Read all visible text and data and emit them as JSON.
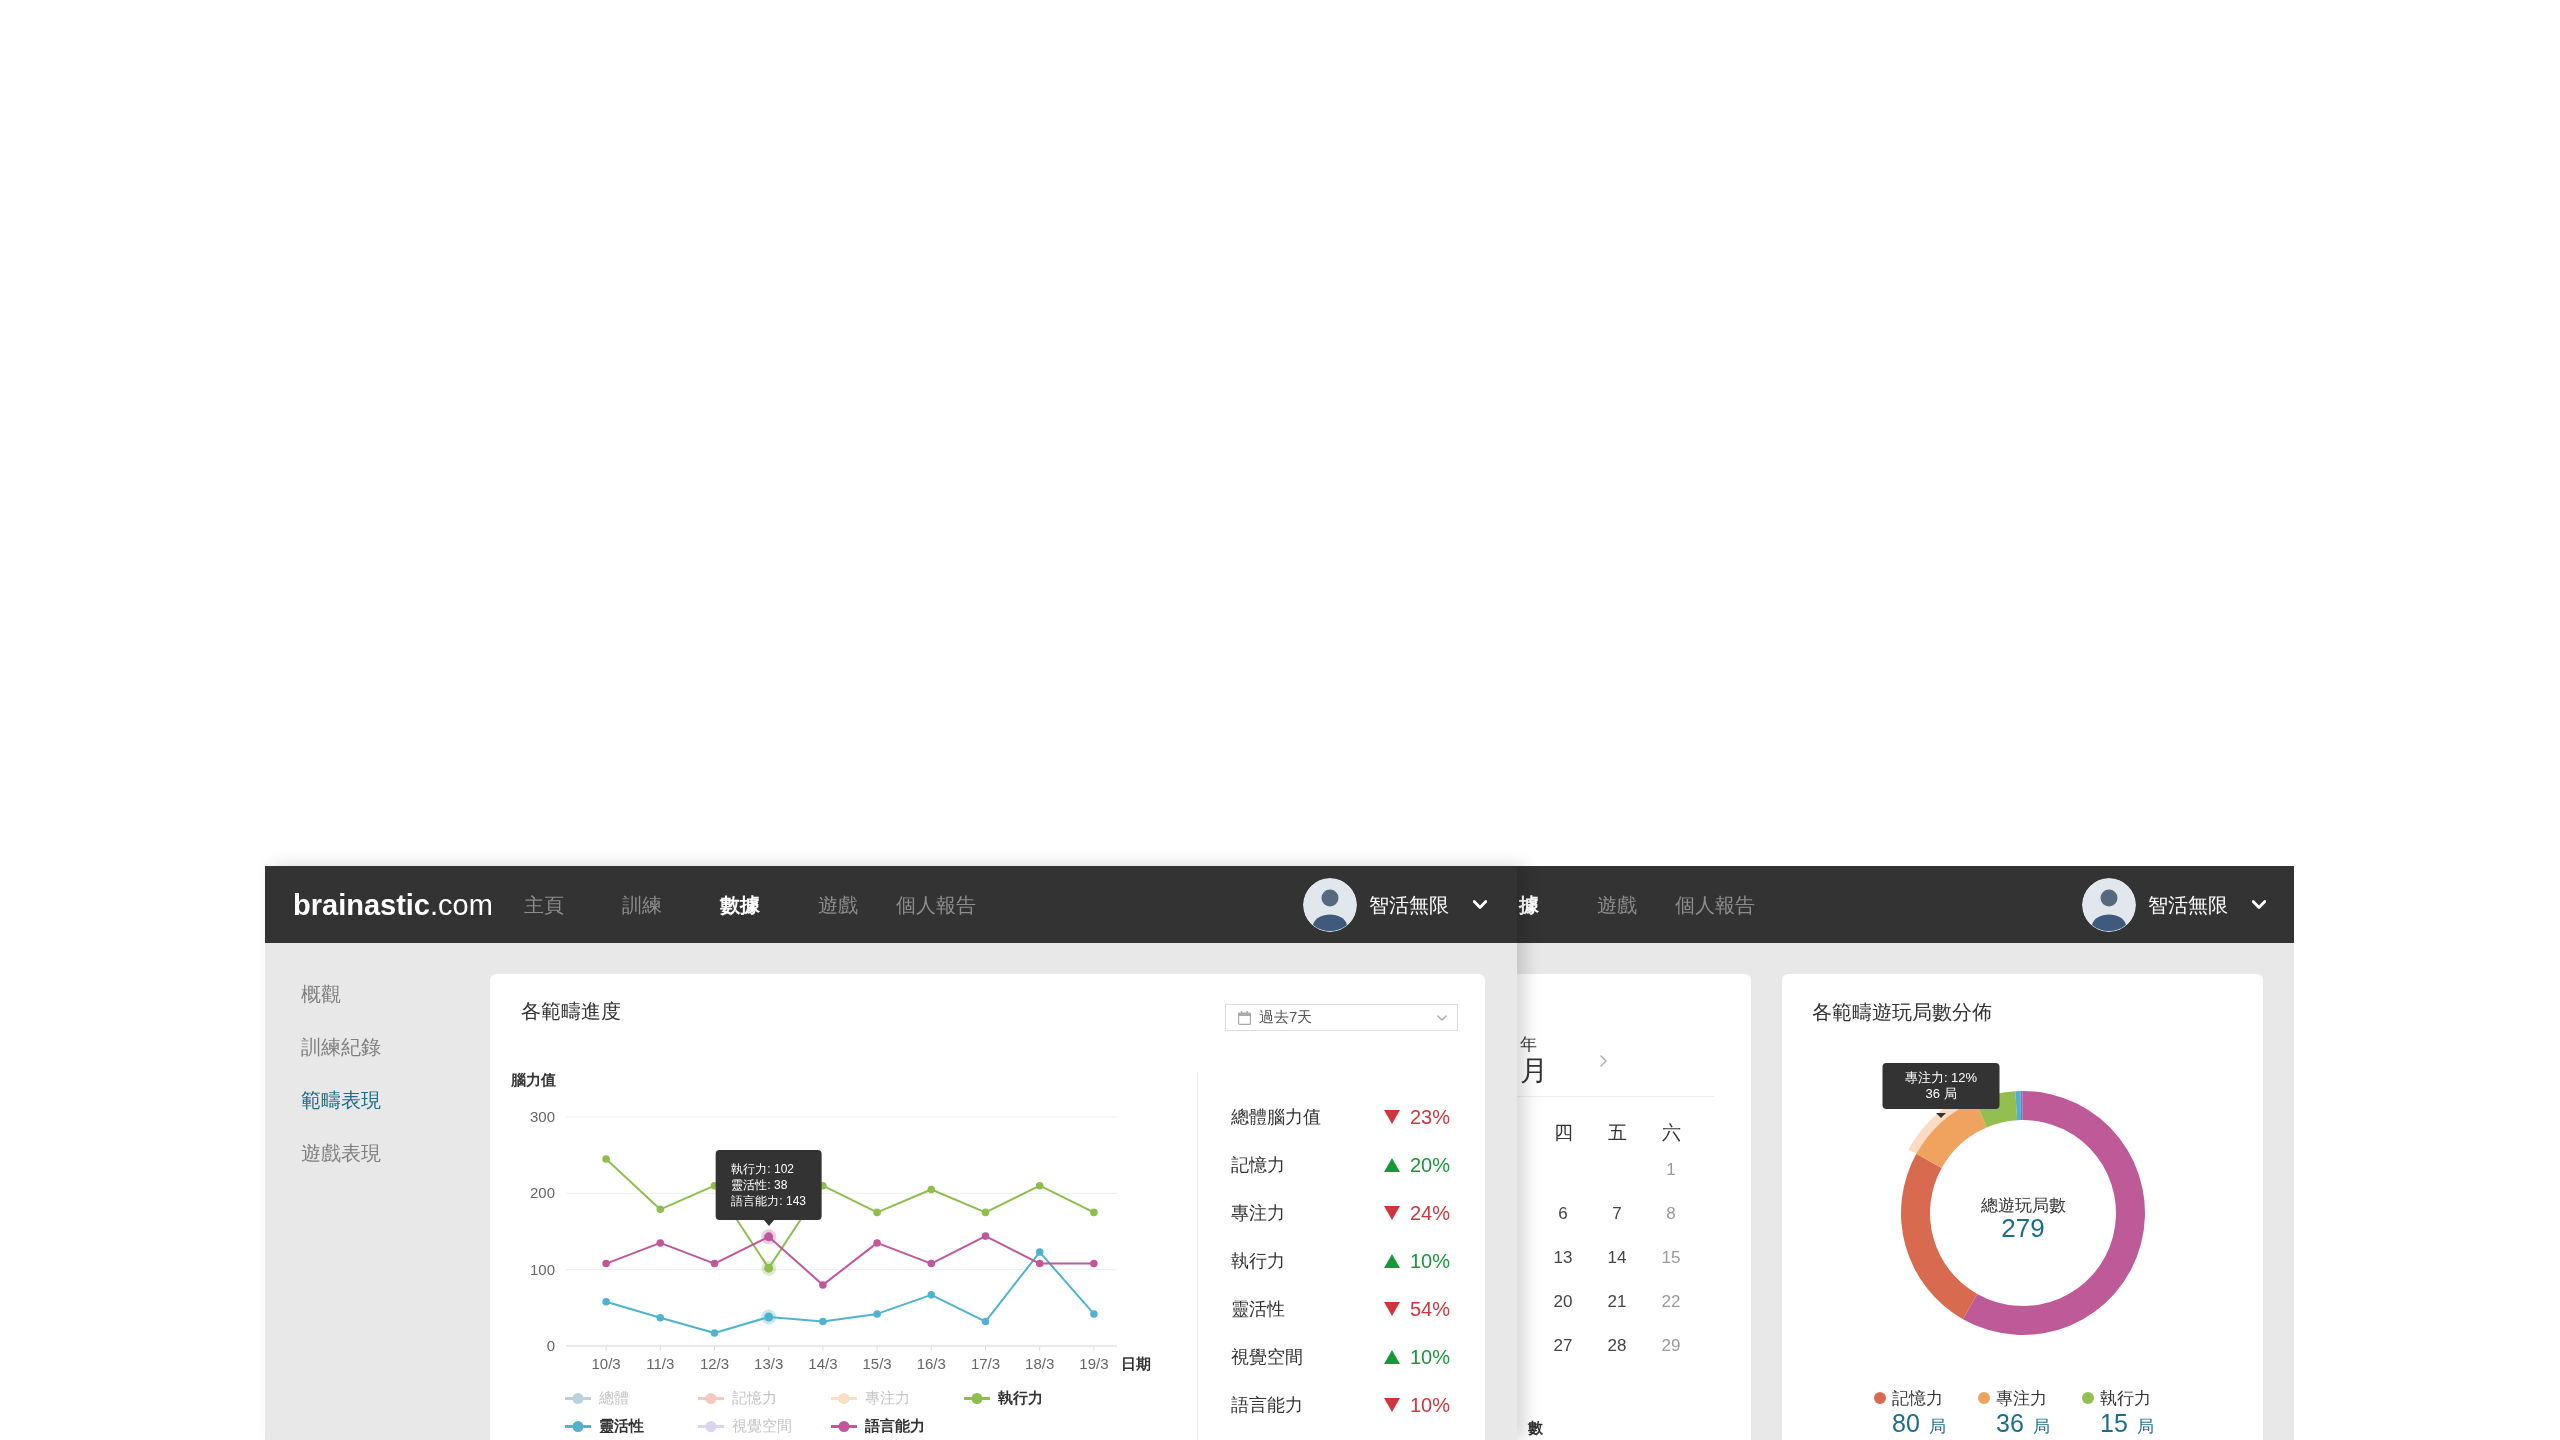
{
  "front_window": {
    "navbar": {
      "logo": "**brainastic**.com",
      "nav": [
        {
          "label": "主頁",
          "selected": false
        },
        {
          "label": "訓練",
          "selected": false
        },
        {
          "label": "數據",
          "selected": true
        },
        {
          "label": "遊戲",
          "selected": false
        },
        {
          "label": "個人報告",
          "selected": false
        }
      ],
      "user": {
        "name": "智活無限"
      }
    },
    "sidebar": {
      "items": [
        {
          "label": "概觀",
          "selected": false
        },
        {
          "label": "訓練紀錄",
          "selected": false
        },
        {
          "label": "範疇表現",
          "selected": true
        },
        {
          "label": "遊戲表現",
          "selected": false
        }
      ]
    },
    "progress_card": {
      "title": "各範疇進度",
      "date_range": {
        "value": "過去7天"
      },
      "chart_data": {
        "type": "line",
        "ylabel": "腦力值",
        "xlabel": "日期",
        "categories": [
          "10/3",
          "11/3",
          "12/3",
          "13/3",
          "14/3",
          "15/3",
          "16/3",
          "17/3",
          "18/3",
          "19/3"
        ],
        "ylim": [
          0,
          300
        ],
        "yticks": [
          0,
          100,
          200,
          300
        ],
        "series": [
          {
            "name": "總體",
            "color": "#b9d2da",
            "marker": "circle",
            "values": [
              null,
              null,
              null,
              null,
              null,
              null,
              null,
              null,
              null,
              null
            ]
          },
          {
            "name": "記憶力",
            "color": "#f5c9bd",
            "marker": "circle",
            "values": [
              null,
              null,
              null,
              null,
              null,
              null,
              null,
              null,
              null,
              null
            ]
          },
          {
            "name": "專注力",
            "color": "#f9ddc5",
            "marker": "circle",
            "values": [
              null,
              null,
              null,
              null,
              null,
              null,
              null,
              null,
              null,
              null
            ]
          },
          {
            "name": "執行力",
            "color": "#8fbe4f",
            "marker": "circle",
            "values": [
              245,
              179,
              210,
              102,
              210,
              175,
              205,
              175,
              210,
              175
            ]
          },
          {
            "name": "靈活性",
            "color": "#4fb3cf",
            "marker": "circle",
            "values": [
              58,
              37,
              17,
              38,
              32,
              42,
              67,
              32,
              123,
              42
            ]
          },
          {
            "name": "視覺空間",
            "color": "#dad4ed",
            "marker": "circle",
            "values": [
              null,
              null,
              null,
              null,
              null,
              null,
              null,
              null,
              null,
              null
            ]
          },
          {
            "name": "語言能力",
            "color": "#c0579b",
            "marker": "circle",
            "values": [
              108,
              135,
              108,
              143,
              80,
              135,
              108,
              144,
              108,
              108
            ]
          }
        ]
      },
      "legend": [
        {
          "selected": false
        },
        {
          "selected": false
        },
        {
          "selected": false
        },
        {
          "selected": true
        },
        {
          "selected": true
        },
        {
          "selected": false
        },
        {
          "selected": true
        }
      ],
      "hovered_dates": [
        false,
        false,
        false,
        true,
        false,
        false,
        false,
        false,
        false,
        false
      ],
      "tooltip": {
        "lines": [
          "執行力: 102",
          "靈活性: 38",
          "語言能力: 143"
        ]
      },
      "changes": [
        {
          "label": "總體腦力值",
          "kind": "down",
          "value": "23%"
        },
        {
          "label": "記憶力",
          "kind": "up",
          "value": "20%"
        },
        {
          "label": "專注力",
          "kind": "down",
          "value": "24%"
        },
        {
          "label": "執行力",
          "kind": "up",
          "value": "10%"
        },
        {
          "label": "靈活性",
          "kind": "down",
          "value": "54%"
        },
        {
          "label": "視覺空間",
          "kind": "up",
          "value": "10%"
        },
        {
          "label": "語言能力",
          "kind": "down",
          "value": "10%"
        }
      ]
    }
  },
  "back_window": {
    "navbar": {
      "nav": [
        {
          "label": "據",
          "selected": true
        },
        {
          "label": "遊戲",
          "selected": false
        },
        {
          "label": "個人報告",
          "selected": false
        }
      ],
      "user": {
        "name": "智活無限"
      }
    },
    "calendar_card": {
      "year_text": "年",
      "month_text": "月",
      "weekdays": [
        "四",
        "五",
        "六"
      ],
      "weeks": [
        [
          {
            "day": "1",
            "weekend": true
          }
        ],
        [
          {
            "day": "6",
            "weekend": false
          },
          {
            "day": "7",
            "weekend": false
          },
          {
            "day": "8",
            "weekend": true
          }
        ],
        [
          {
            "day": "13",
            "weekend": false
          },
          {
            "day": "14",
            "weekend": false
          },
          {
            "day": "15",
            "weekend": true
          }
        ],
        [
          {
            "day": "20",
            "weekend": false
          },
          {
            "day": "21",
            "weekend": false
          },
          {
            "day": "22",
            "weekend": true
          }
        ],
        [
          {
            "day": "27",
            "weekend": false
          },
          {
            "day": "28",
            "weekend": false
          },
          {
            "day": "29",
            "weekend": true
          }
        ]
      ],
      "footer_text": "數"
    },
    "distribution_card": {
      "title": "各範疇遊玩局數分佈",
      "tooltip": {
        "lines": [
          "專注力: 12%",
          "36 局"
        ]
      },
      "total": {
        "label": "總遊玩局數",
        "value": "279"
      },
      "legend": [
        {
          "label": "記憶力",
          "color": "#d86a50",
          "count": "80",
          "unit": "局"
        },
        {
          "label": "專注力",
          "color": "#efa35f",
          "count": "36",
          "unit": "局"
        },
        {
          "label": "執行力",
          "color": "#93bf50",
          "count": "15",
          "unit": "局"
        }
      ]
    }
  }
}
